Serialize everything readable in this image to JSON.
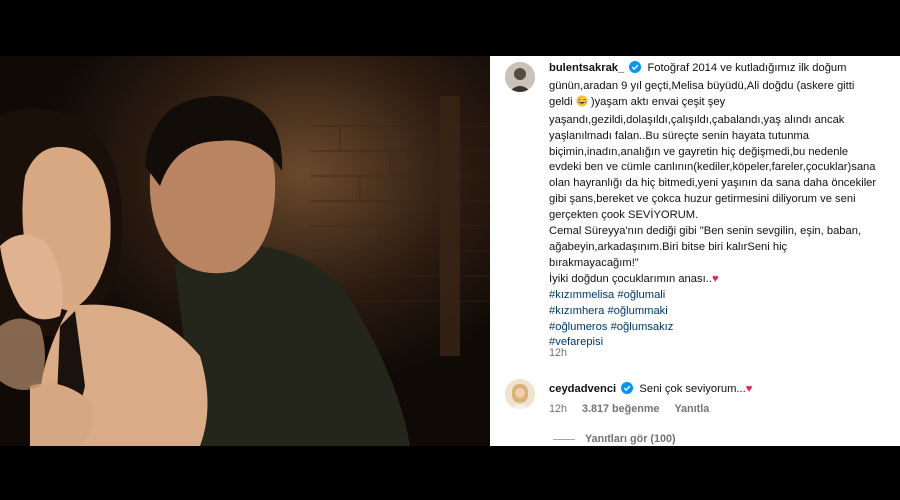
{
  "post": {
    "author": "bulentsakrak_",
    "caption_lines": [
      "Fotoğraf 2014 ve kutladığımız ilk doğum",
      "günün,aradan 9 yıl geçti,Melisa büyüdü,Ali doğdu (askere gitti",
      "geldi",
      ")yaşam aktı envai çeşit şey",
      "yaşandı,gezildi,dolaşıldı,çalışıldı,çabalandı,yaş alındı ancak",
      "yaşlanılmadı falan..Bu süreçte senin hayata tutunma",
      "biçimin,inadın,analığın ve gayretin hiç değişmedi,bu nedenle",
      "evdeki ben ve cümle canlının(kediler,köpeler,fareler,çocuklar)sana",
      "olan hayranlığı da hiç bitmedi,yeni yaşının da sana daha öncekiler",
      "gibi şans,bereket ve çokca huzur getirmesini diliyorum ve seni",
      "gerçekten çook SEVİYORUM.",
      "Cemal Süreyya'nın dediği gibi \"Ben senin sevgilin, eşin, baban,",
      "ağabeyin,arkadaşınım.Biri bitse biri kalırSeni hiç",
      "bırakmayacağım!\"",
      "İyiki doğdun çocuklarımın anası.."
    ],
    "hashtags": [
      [
        "#kızımmelisa",
        "#oğlumali"
      ],
      [
        "#kızımhera",
        "#oğlummaki"
      ],
      [
        "#oğlumeros",
        "#oğlumsakız"
      ],
      [
        "#vefarepisi"
      ]
    ],
    "time": "12h"
  },
  "comment": {
    "author": "ceydadvenci",
    "text": "Seni çok seviyorum...",
    "time": "12h",
    "likes": "3.817 beğenme",
    "reply_label": "Yanıtla",
    "view_replies": "Yanıtları gör (100)"
  },
  "icons": {
    "verified": "verified-badge-icon",
    "heart": "red-heart-emoji-icon",
    "laugh": "laughing-tears-emoji-icon"
  },
  "colors": {
    "verified": "#0095f6",
    "hashtag": "#00376b",
    "heart": "#e0245e",
    "meta": "#737373"
  }
}
